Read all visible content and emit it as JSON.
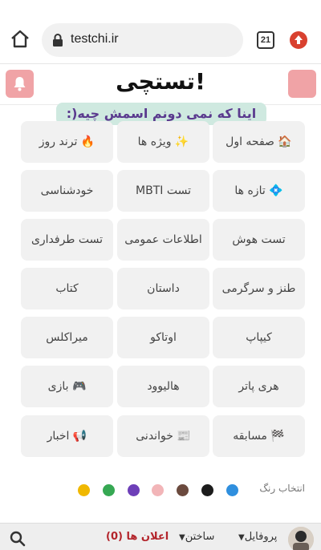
{
  "browser": {
    "url": "testchi.ir",
    "tab_count": "21",
    "icons": [
      "home-icon",
      "lock-icon",
      "tabs-icon",
      "update-icon"
    ]
  },
  "header": {
    "logo_text": "تستچی!",
    "tagline": "اینا که نمی دونم اسمش چیه(:"
  },
  "categories": [
    {
      "label": "🏠 صفحه اول"
    },
    {
      "label": "✨ ویژه ها"
    },
    {
      "label": "🔥 ترند روز"
    },
    {
      "label": "💠 تازه ها"
    },
    {
      "label": "تست MBTI"
    },
    {
      "label": "خودشناسی"
    },
    {
      "label": "تست هوش"
    },
    {
      "label": "اطلاعات عمومی"
    },
    {
      "label": "تست طرفداری"
    },
    {
      "label": "طنز و سرگرمی"
    },
    {
      "label": "داستان"
    },
    {
      "label": "کتاب"
    },
    {
      "label": "کیپاپ"
    },
    {
      "label": "اوتاکو"
    },
    {
      "label": "میراکلس"
    },
    {
      "label": "هری پاتر"
    },
    {
      "label": "هالیوود"
    },
    {
      "label": "🎮 بازی"
    },
    {
      "label": "🏁 مسابقه"
    },
    {
      "label": "📰 خواندنی"
    },
    {
      "label": "📢 اخبار"
    }
  ],
  "color_picker": {
    "label": "انتخاب رنگ",
    "colors": [
      "#2f8fde",
      "#1c1c1c",
      "#6b4a3e",
      "#f2b5b8",
      "#6d3fb8",
      "#36a853",
      "#f0b800"
    ]
  },
  "bottom_bar": {
    "profile_label": "پروفایل",
    "build_label": "ساختن",
    "ads_label": "اعلان ها (0)"
  },
  "theme": {
    "accent": "#f0a3a6",
    "tagline_bg": "#cfe9e0",
    "ads_color": "#b3242b"
  }
}
